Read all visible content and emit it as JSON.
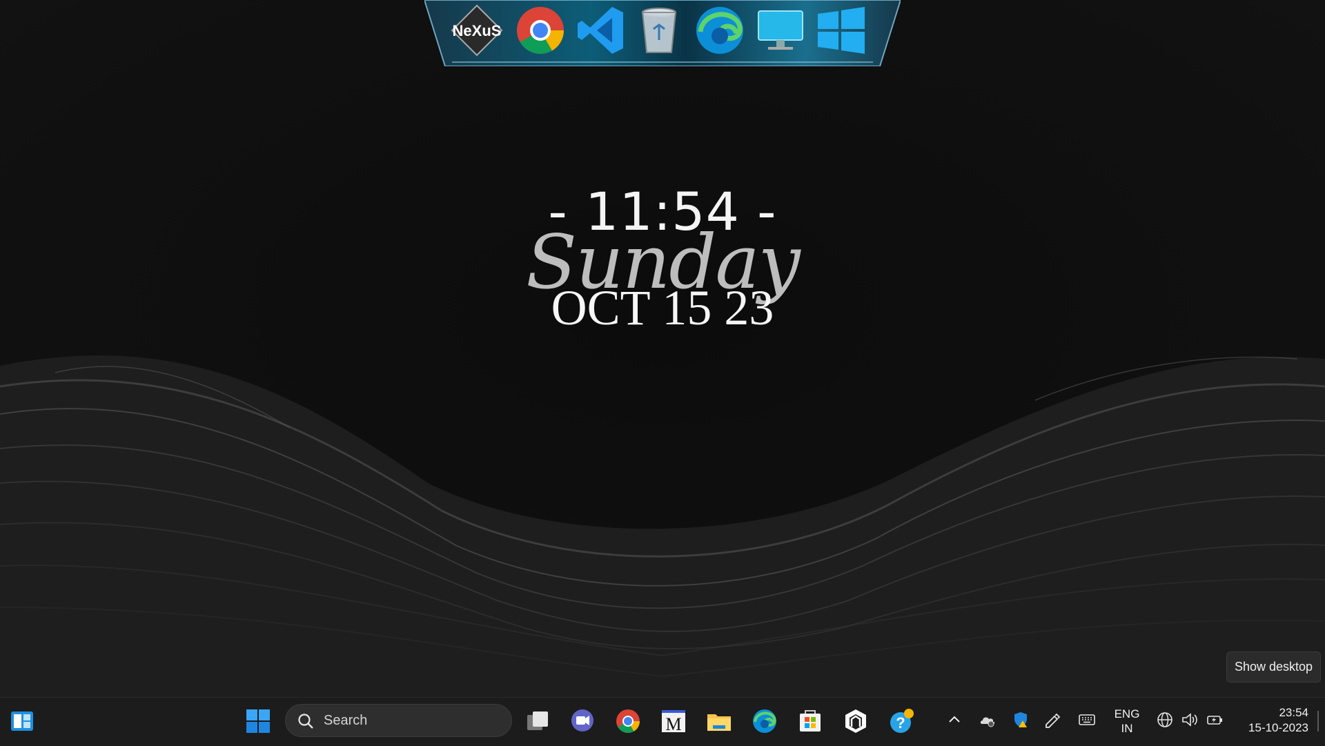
{
  "dock": {
    "items": [
      {
        "name": "Nexus",
        "icon": "nexus-logo"
      },
      {
        "name": "Google Chrome",
        "icon": "chrome-icon"
      },
      {
        "name": "Visual Studio Code",
        "icon": "vscode-icon"
      },
      {
        "name": "Recycle Bin",
        "icon": "recycle-bin-icon"
      },
      {
        "name": "Microsoft Edge",
        "icon": "edge-icon"
      },
      {
        "name": "This PC",
        "icon": "monitor-icon"
      },
      {
        "name": "Windows",
        "icon": "windows-icon"
      }
    ],
    "nexus_text": "NeXuS"
  },
  "clock_widget": {
    "time": "- 11:54 -",
    "day": "Sunday",
    "date": "OCT 15 23"
  },
  "tooltip": {
    "text": "Show desktop"
  },
  "taskbar": {
    "search_placeholder": "Search",
    "pinned": [
      {
        "name": "Widgets",
        "icon": "widgets-icon"
      },
      {
        "name": "Start",
        "icon": "windows-start-icon"
      },
      {
        "name": "Task View",
        "icon": "task-view-icon"
      },
      {
        "name": "Teams Chat",
        "icon": "teams-chat-icon"
      },
      {
        "name": "Google Chrome",
        "icon": "chrome-icon"
      },
      {
        "name": "M App",
        "icon": "m-app-icon"
      },
      {
        "name": "File Explorer",
        "icon": "file-explorer-icon"
      },
      {
        "name": "Microsoft Edge",
        "icon": "edge-icon"
      },
      {
        "name": "Microsoft Store",
        "icon": "store-icon"
      },
      {
        "name": "Store Hexagon App",
        "icon": "hexagon-app-icon"
      },
      {
        "name": "Get Help",
        "icon": "help-icon"
      }
    ],
    "tray": {
      "language_line1": "ENG",
      "language_line2": "IN",
      "time": "23:54",
      "date": "15-10-2023"
    }
  },
  "colors": {
    "accent_blue": "#0078d4",
    "taskbar_bg": "#1c1c1c",
    "wallpaper_bg": "#0b0b0b"
  }
}
